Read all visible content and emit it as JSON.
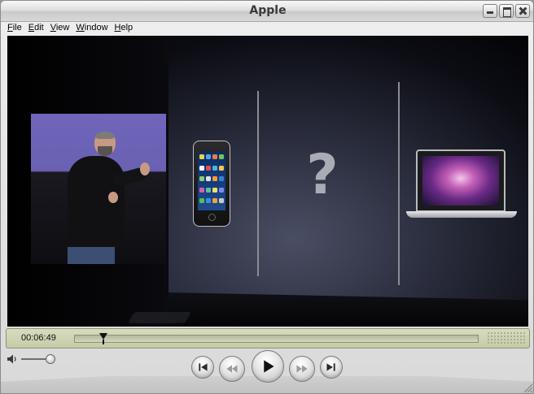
{
  "window": {
    "title": "Apple"
  },
  "menu": [
    {
      "label": "File",
      "u": "F",
      "rest": "ile"
    },
    {
      "label": "Edit",
      "u": "E",
      "rest": "dit"
    },
    {
      "label": "View",
      "u": "V",
      "rest": "iew"
    },
    {
      "label": "Window",
      "u": "W",
      "rest": "indow"
    },
    {
      "label": "Help",
      "u": "H",
      "rest": "elp"
    }
  ],
  "video": {
    "slide_question_mark": "?"
  },
  "playback": {
    "time": "00:06:49",
    "progress_fraction": 0.07
  },
  "volume": {
    "level_fraction": 0.9
  },
  "colors": {
    "status_bar": "#d0d4b4",
    "slide_purple": "#6a61b3"
  },
  "icons": {
    "speaker": "speaker-icon",
    "previous": "skip-back-icon",
    "rewind": "rewind-icon",
    "play": "play-icon",
    "fast_forward": "fast-forward-icon",
    "next": "skip-forward-icon"
  }
}
